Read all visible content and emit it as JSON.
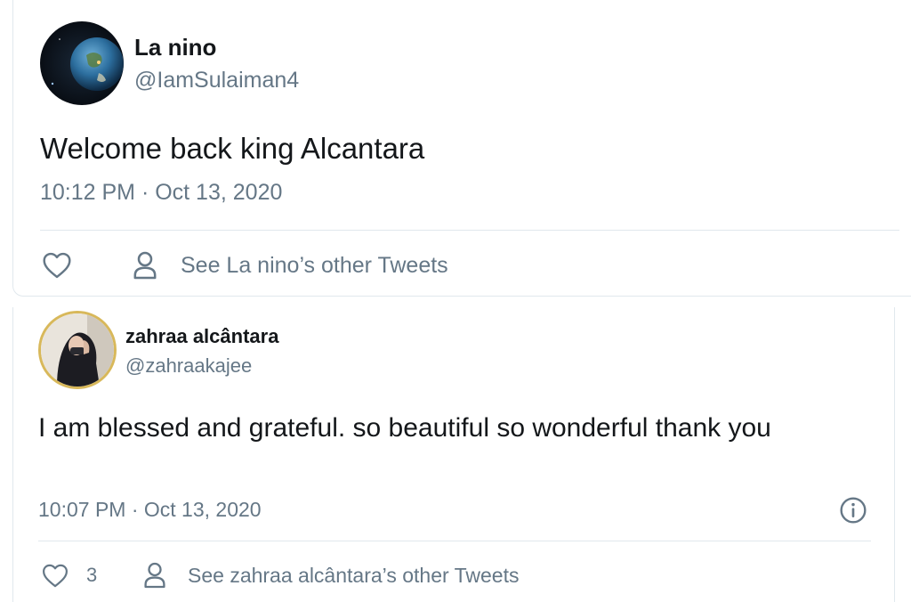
{
  "tweets": [
    {
      "author_name": "La nino",
      "handle": "@IamSulaiman4",
      "text": "Welcome back king Alcantara",
      "timestamp": "10:12 PM · Oct 13, 2020",
      "like_count": "",
      "other_tweets_label": "See La nino’s other Tweets",
      "avatar": "earth-from-space-icon",
      "show_info_icon": false
    },
    {
      "author_name": "zahraa alcântara",
      "handle": "@zahraakajee",
      "text": "I am blessed and grateful. so beautiful so wonderful thank you",
      "timestamp": "10:07 PM · Oct 13, 2020",
      "like_count": "3",
      "other_tweets_label": "See zahraa alcântara’s other Tweets",
      "avatar": "person-in-hijab-icon",
      "show_info_icon": true
    }
  ],
  "icons": {
    "like": "heart-outline-icon",
    "profile": "person-outline-icon",
    "info": "info-circle-icon"
  },
  "colors": {
    "text_primary": "#14171a",
    "text_secondary": "#657786",
    "divider": "#e1e8ed",
    "avatar_ring": "#d8b85a"
  }
}
